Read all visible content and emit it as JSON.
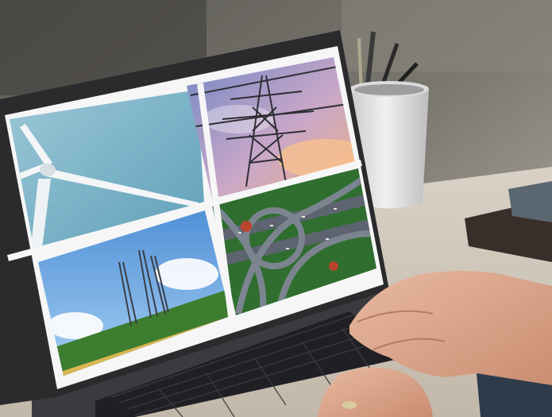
{
  "scene": {
    "subject": "laptop-on-desk",
    "screen_tiles": [
      {
        "id": "wind-turbine"
      },
      {
        "id": "power-pylon"
      },
      {
        "id": "telecom-towers"
      },
      {
        "id": "highway-interchange"
      }
    ]
  },
  "colors": {
    "background_shelf": "#6b6a64",
    "desk": "#cfc6ba",
    "laptop_body": "#2b2b2e",
    "screen_border": "#f6f6f7",
    "sky_blue": "#86bde6",
    "field_yellow": "#d9b652",
    "skin": "#d9a48a"
  }
}
